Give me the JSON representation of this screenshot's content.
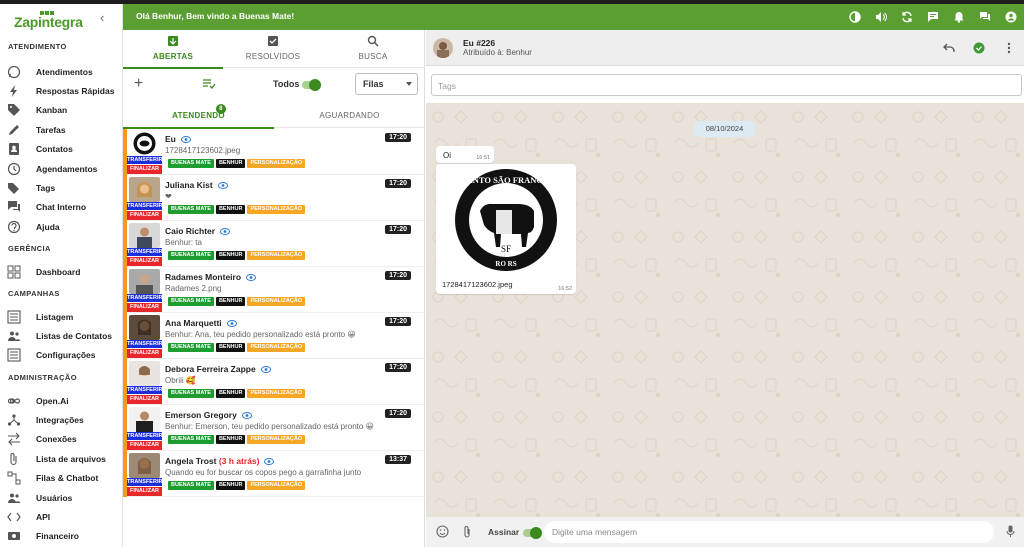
{
  "brand": {
    "name": "Zapintegra",
    "color": "#5b9e32"
  },
  "header": {
    "welcome": "Olá Benhur, Bem vindo a Buenas Mate!"
  },
  "sidebar": {
    "sections": [
      {
        "title": "ATENDIMENTO",
        "items": [
          {
            "label": "Atendimentos",
            "icon": "whatsapp-icon"
          },
          {
            "label": "Respostas Rápidas",
            "icon": "bolt-icon"
          },
          {
            "label": "Kanban",
            "icon": "tag-icon"
          },
          {
            "label": "Tarefas",
            "icon": "pencil-icon"
          },
          {
            "label": "Contatos",
            "icon": "contacts-icon"
          },
          {
            "label": "Agendamentos",
            "icon": "clock-icon"
          },
          {
            "label": "Tags",
            "icon": "tags-icon"
          },
          {
            "label": "Chat Interno",
            "icon": "chat-icon"
          },
          {
            "label": "Ajuda",
            "icon": "help-icon"
          }
        ]
      },
      {
        "title": "GERÊNCIA",
        "items": [
          {
            "label": "Dashboard",
            "icon": "dashboard-icon"
          }
        ]
      },
      {
        "title": "CAMPANHAS",
        "items": [
          {
            "label": "Listagem",
            "icon": "list-icon"
          },
          {
            "label": "Listas de Contatos",
            "icon": "people-icon"
          },
          {
            "label": "Configurações",
            "icon": "list-icon"
          }
        ]
      },
      {
        "title": "ADMINISTRAÇÃO",
        "items": [
          {
            "label": "Open.Ai",
            "icon": "infinity-icon"
          },
          {
            "label": "Integrações",
            "icon": "integration-icon"
          },
          {
            "label": "Conexões",
            "icon": "swap-icon"
          },
          {
            "label": "Lista de arquivos",
            "icon": "attach-icon"
          },
          {
            "label": "Filas & Chatbot",
            "icon": "queue-icon"
          },
          {
            "label": "Usuários",
            "icon": "people-icon"
          },
          {
            "label": "API",
            "icon": "code-icon"
          },
          {
            "label": "Financeiro",
            "icon": "money-icon"
          }
        ]
      }
    ]
  },
  "ticket_tabs": {
    "open": "ABERTAS",
    "resolved": "RESOLVIDOS",
    "search": "BUSCA"
  },
  "filters": {
    "todos": "Todos",
    "filas": "Filas"
  },
  "subtabs": {
    "attending": "ATENDENDO",
    "attending_count": "8",
    "waiting": "AGUARDANDO"
  },
  "ticket_actions": {
    "transfer": "TRANSFERIR",
    "finish": "FINALIZAR"
  },
  "tag_colors": {
    "buenas": "#1e9c2e",
    "benhur": "#111111",
    "personal": "#f5a623"
  },
  "tickets": [
    {
      "name": "Eu",
      "ago": "",
      "message": "1728417123602.jpeg",
      "time": "17:20",
      "avatar": "cow"
    },
    {
      "name": "Juliana Kist",
      "ago": "",
      "message": "❤",
      "time": "17:20",
      "avatar": "blonde"
    },
    {
      "name": "Caio Richter",
      "ago": "",
      "message": "Benhur: ta",
      "time": "17:20",
      "avatar": "man-car"
    },
    {
      "name": "Radames Monteiro",
      "ago": "",
      "message": "Radames 2.png",
      "time": "17:20",
      "avatar": "man-gray"
    },
    {
      "name": "Ana Marquetti",
      "ago": "",
      "message": "Benhur: Ana, teu pedido personalizado está pronto 😀",
      "time": "17:20",
      "avatar": "woman-dark"
    },
    {
      "name": "Debora Ferreira Zappe",
      "ago": "",
      "message": "Obriii 🥰",
      "time": "17:20",
      "avatar": "woman-light"
    },
    {
      "name": "Emerson Gregory",
      "ago": "",
      "message": "Benhur: Emerson, teu pedido personalizado está pronto 😀",
      "time": "17:20",
      "avatar": "man-suit"
    },
    {
      "name": "Angela Trost",
      "ago": "(3 h atrás)",
      "message": "Quando eu for buscar os copos pego a garrafinha junto",
      "time": "13:37",
      "avatar": "woman-brown"
    }
  ],
  "tag_labels": {
    "buenas": "BUENAS MATE",
    "benhur": "BENHUR",
    "personal": "PERSONALIZAÇÃO"
  },
  "chat": {
    "title": "Eu #226",
    "assigned": "Atribuído à: Benhur",
    "tags_placeholder": "Tags",
    "date": "08/10/2024",
    "messages": [
      {
        "text": "Oi",
        "time": "16:51"
      },
      {
        "text": "1728417123602.jpeg",
        "time": "16:52"
      }
    ],
    "logo_text_top": "RECANTO SÃO FRANCISCO",
    "logo_text_bottom": "RO          RS",
    "logo_mono": "SF",
    "sign_label": "Assinar",
    "message_placeholder": "Digite uma mensagem"
  }
}
